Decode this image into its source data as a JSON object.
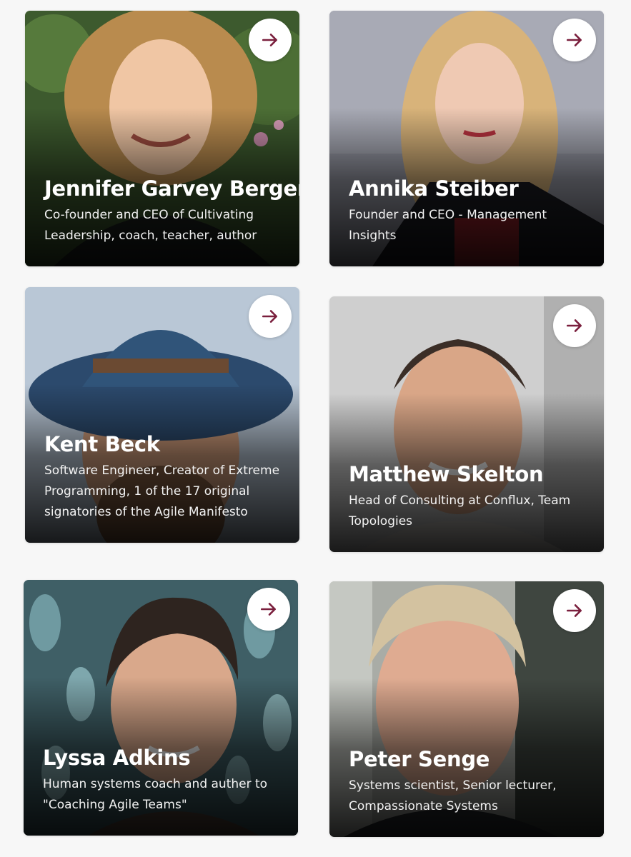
{
  "speakers": [
    {
      "name": "Jennifer Garvey Berger",
      "role": "Co-founder and CEO of Cultivating Leadership, coach, teacher, author",
      "photo_icon": "portrait-curly-blonde-woman-icon"
    },
    {
      "name": "Annika Steiber",
      "role": "Founder and CEO - Management Insights",
      "photo_icon": "portrait-blonde-woman-icon"
    },
    {
      "name": "Kent Beck",
      "role": "Software Engineer, Creator of Extreme Programming, 1 of the 17 original signatories of the Agile Manifesto",
      "photo_icon": "portrait-man-blue-hat-icon"
    },
    {
      "name": "Matthew Skelton",
      "role": "Head of Consulting at Conflux, Team Topologies",
      "photo_icon": "portrait-dark-haired-man-icon"
    },
    {
      "name": "Lyssa Adkins",
      "role": "Human systems coach and auther to \"Coaching Agile Teams\"",
      "photo_icon": "portrait-short-haired-woman-icon"
    },
    {
      "name": "Peter Senge",
      "role": "Systems scientist, Senior lecturer, Compassionate Systems",
      "photo_icon": "portrait-grey-haired-man-icon"
    }
  ],
  "colors": {
    "arrow_accent": "#7a1f3d",
    "background": "#f7f7f7"
  },
  "arrow_icon": "arrow-right-icon"
}
